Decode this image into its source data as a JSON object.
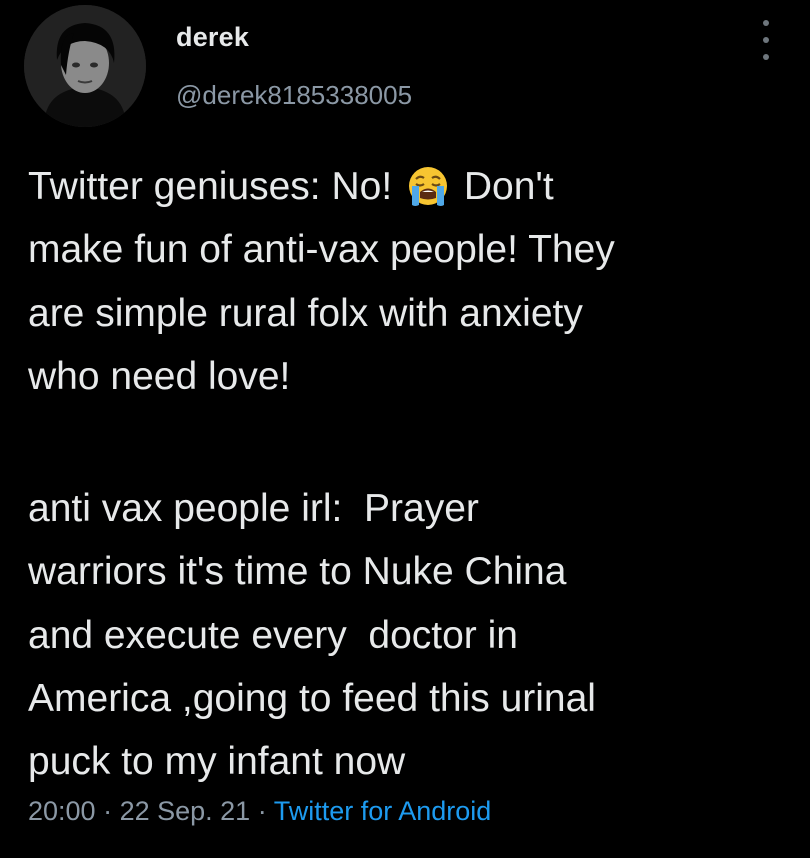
{
  "author": {
    "display_name": "derek",
    "handle": "@derek8185338005",
    "avatar_icon": "profile-photo"
  },
  "menu_icon": "more-options-icon",
  "tweet": {
    "line1_before_emoji": "Twitter geniuses: No! ",
    "emoji": "loudly-crying-face",
    "line1_after_emoji": " Don't",
    "rest_of_paragraph1": "make fun of anti-vax people! They\nare simple rural folx with anxiety\nwho need love!",
    "paragraph2": "anti vax people irl:  Prayer\nwarriors it's time to Nuke China\nand execute every  doctor in\nAmerica ,going to feed this urinal\npuck to my infant now"
  },
  "meta": {
    "time": "20:00",
    "separator1": " · ",
    "date": "22 Sep. 21",
    "separator2": " · ",
    "source": "Twitter for Android"
  },
  "colors": {
    "background": "#000000",
    "text": "#e7e9ea",
    "secondary": "#8b98a5",
    "link": "#1d9bf0"
  }
}
